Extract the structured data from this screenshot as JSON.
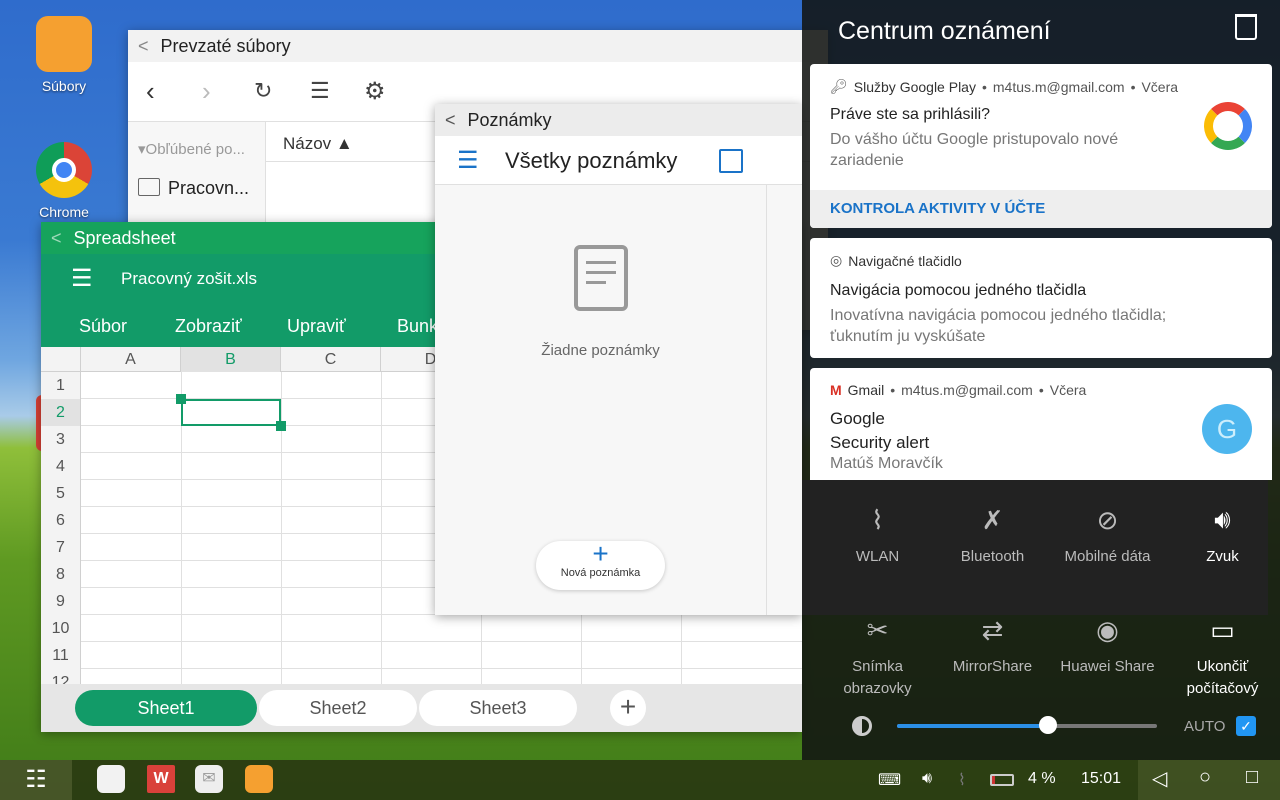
{
  "desktop": {
    "icons": [
      {
        "label": "Súbory"
      },
      {
        "label": "Chrome"
      }
    ]
  },
  "files_window": {
    "title": "Prevzaté súbory",
    "sidebar": {
      "section": "▾Obľúbené po...",
      "item": "Pracovn..."
    },
    "column_header": "Názov ▲"
  },
  "notes_window": {
    "title": "Poznámky",
    "header": "Všetky poznámky",
    "empty_text": "Žiadne poznámky",
    "new_note_label": "Nová poznámka"
  },
  "spreadsheet": {
    "title": "Spreadsheet",
    "file_name": "Pracovný zošit.xls",
    "menu": [
      "Súbor",
      "Zobraziť",
      "Upraviť",
      "Bunk"
    ],
    "columns": [
      "A",
      "B",
      "C",
      "D"
    ],
    "rows": [
      "1",
      "2",
      "3",
      "4",
      "5",
      "6",
      "7",
      "8",
      "9",
      "10",
      "11",
      "12"
    ],
    "selected_cell": "B2",
    "sheets": [
      "Sheet1",
      "Sheet2",
      "Sheet3"
    ],
    "active_sheet": "Sheet1",
    "accent": "#129b68"
  },
  "notifications": {
    "title": "Centrum oznámení",
    "cards": [
      {
        "app": "Služby Google Play",
        "account": "m4tus.m@gmail.com",
        "time": "Včera",
        "title": "Práve ste sa prihlásili?",
        "text": "Do vášho účtu Google pristupovalo nové zariadenie",
        "action": "KONTROLA AKTIVITY V ÚČTE"
      },
      {
        "app": "Navigačné tlačidlo",
        "title": "Navigácia pomocou jedného tlačidla",
        "text": "Inovatívna navigácia pomocou jedného tlačidla; ťuknutím ju vyskúšate"
      },
      {
        "app": "Gmail",
        "account": "m4tus.m@gmail.com",
        "time": "Včera",
        "title": "Google",
        "subtitle": "Security alert",
        "text": "Matúš Moravčík",
        "avatar": "G"
      }
    ]
  },
  "quick_settings": {
    "row1": [
      {
        "label": "WLAN",
        "icon": "wifi-off-icon"
      },
      {
        "label": "Bluetooth",
        "icon": "bluetooth-off-icon"
      },
      {
        "label": "Mobilné dáta",
        "icon": "mobile-data-off-icon"
      },
      {
        "label": "Zvuk",
        "icon": "sound-icon"
      }
    ],
    "row2": [
      {
        "label": "Snímka obrazovky",
        "icon": "screenshot-icon"
      },
      {
        "label": "MirrorShare",
        "icon": "mirrorshare-icon"
      },
      {
        "label": "Huawei Share",
        "icon": "huawei-share-icon"
      },
      {
        "label": "Ukončiť počítačový",
        "icon": "desktop-mode-icon"
      }
    ],
    "brightness_percent": 58,
    "auto_label": "AUTO",
    "auto_checked": true
  },
  "taskbar": {
    "battery": "4 %",
    "time": "15:01"
  }
}
